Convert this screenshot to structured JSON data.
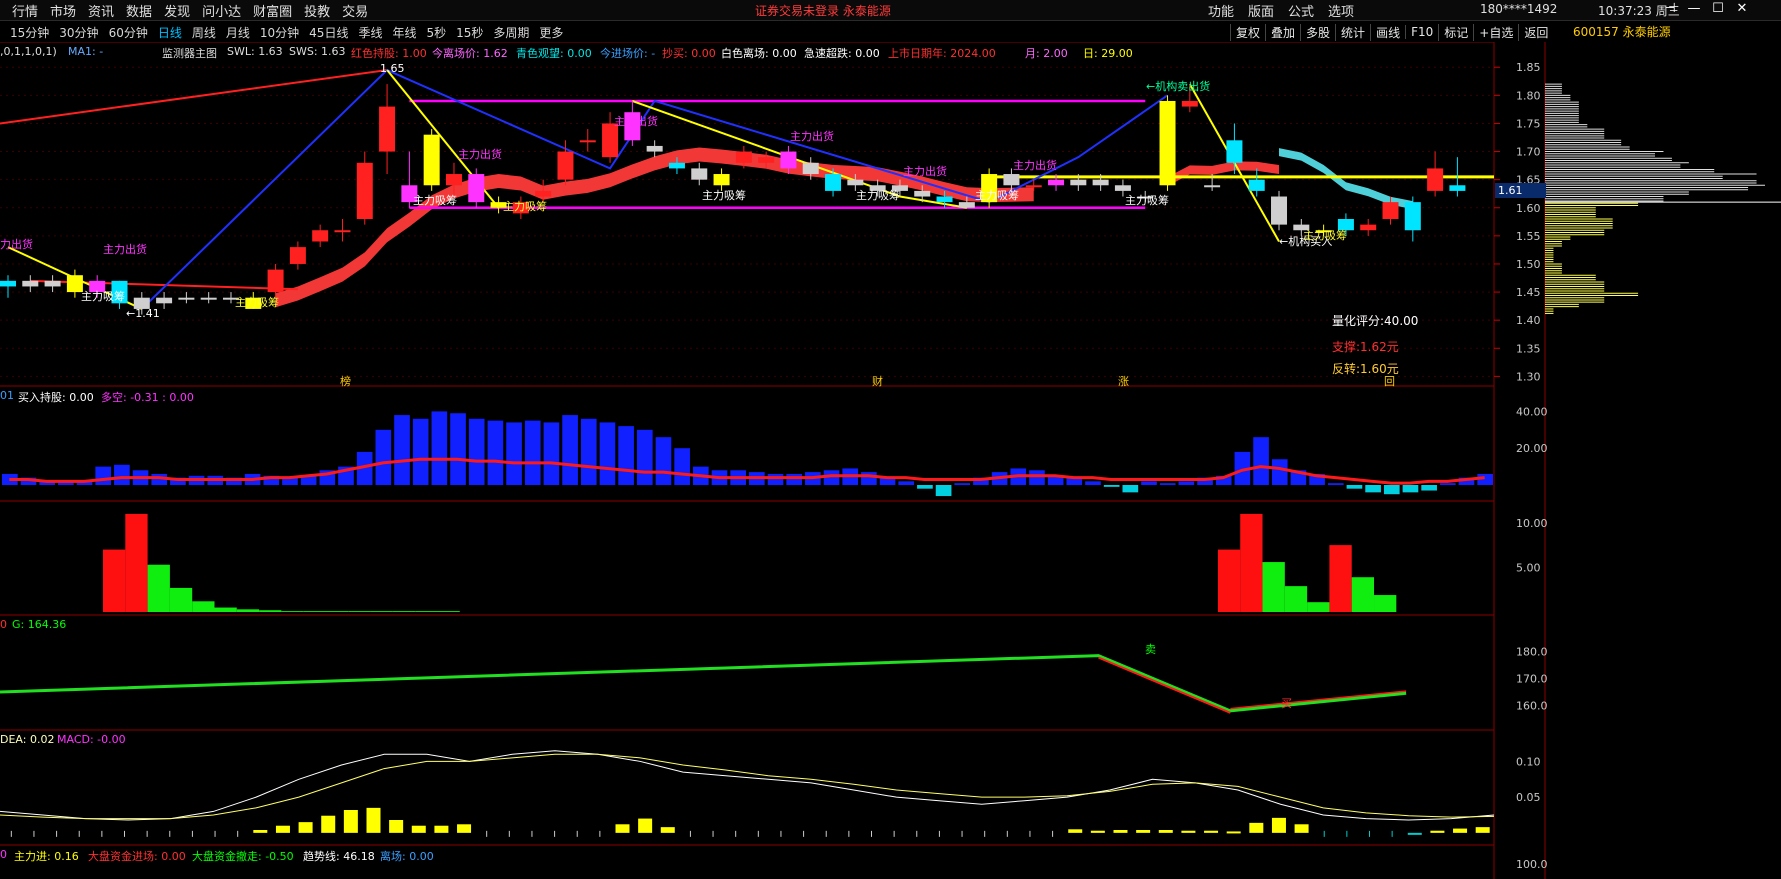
{
  "menu": [
    "行情",
    "市场",
    "资讯",
    "数据",
    "发现",
    "问小达",
    "财富圈",
    "投教",
    "交易"
  ],
  "center_msg": "证券交易未登录  永泰能源",
  "right_menu": [
    "功能",
    "版面",
    "公式",
    "选项"
  ],
  "account": "180****1492",
  "clock": "10:37:23 周三",
  "tabs": [
    "15分钟",
    "30分钟",
    "60分钟",
    "日线",
    "周线",
    "月线",
    "10分钟",
    "45日线",
    "季线",
    "年线",
    "5秒",
    "15秒",
    "多周期",
    "更多"
  ],
  "active_tab": "日线",
  "tools": [
    "复权",
    "叠加",
    "多股",
    "统计",
    "画线",
    "F10",
    "标记",
    "+自选",
    "返回"
  ],
  "stock": {
    "code": "600157",
    "name": "永泰能源"
  },
  "colors": {
    "up": "#ff2020",
    "down": "#00ff00",
    "accent": "#00bfff",
    "yellow": "#ffff00",
    "magenta": "#ff00ff"
  },
  "main_info": {
    "prefix": ",0,1,1,0,1)",
    "ma": "MA1: -",
    "title": "监测器主图",
    "swl": "SWL: 1.63",
    "sws": "SWS: 1.63",
    "red_hold": "红色持股: 1.00",
    "today_leave": "今离场价: 1.62",
    "cyan_watch": "青色观望: 0.00",
    "today_enter": "今进场价: -",
    "bottom_buy": "抄买: 0.00",
    "white_leave": "白色离场: 0.00",
    "super_drop": "急速超跌: 0.00",
    "listing_year": "上市日期年: 2024.00",
    "month": "月: 2.00",
    "day": "日: 29.00"
  },
  "annotations": {
    "inst_sell": "←机构卖出货",
    "inst_buy": "←机构买入",
    "big_out": "主力出货",
    "big_in": "主力吸筹",
    "left_out_cut": "力出货",
    "high_label": "1.65",
    "low_label": "←1.41",
    "events": [
      "榜",
      "财",
      "涨",
      "回"
    ]
  },
  "scores": {
    "quant": "量化评分:40.00",
    "support": "支撑:1.62元",
    "reverse": "反转:1.60元"
  },
  "panel2": {
    "prefix": "01",
    "buy_hold": "买入持股: 0.00",
    "long_short": "多空: -0.31 : 0.00"
  },
  "panel4": {
    "prefix": "0",
    "g": "G: 164.36",
    "sell": "卖",
    "buy": "买"
  },
  "panel5": {
    "prefix": "DEA: 0.02",
    "macd": "MACD: -0.00"
  },
  "panel6": {
    "prefix": "0",
    "main_in": "主力进: 0.16",
    "dp_in": "大盘资金进场: 0.00",
    "dp_out": "大盘资金撤走: -0.50",
    "trend": "趋势线: 46.18",
    "leave": "离场: 0.00"
  },
  "current_price": "1.61",
  "chart_data": {
    "type": "candlestick",
    "main_ticks": [
      1.85,
      1.8,
      1.75,
      1.7,
      1.65,
      1.6,
      1.55,
      1.5,
      1.45,
      1.4,
      1.35,
      1.3
    ],
    "ylim": [
      1.29,
      1.87
    ],
    "candles": [
      [
        1.47,
        1.46,
        1.48,
        1.44
      ],
      [
        1.46,
        1.47,
        1.48,
        1.45
      ],
      [
        1.46,
        1.47,
        1.48,
        1.45
      ],
      [
        1.48,
        1.45,
        1.49,
        1.44
      ],
      [
        1.45,
        1.47,
        1.48,
        1.44
      ],
      [
        1.47,
        1.43,
        1.47,
        1.42
      ],
      [
        1.44,
        1.42,
        1.45,
        1.41
      ],
      [
        1.43,
        1.44,
        1.45,
        1.42
      ],
      [
        1.44,
        1.44,
        1.45,
        1.43
      ],
      [
        1.44,
        1.44,
        1.45,
        1.43
      ],
      [
        1.44,
        1.44,
        1.45,
        1.43
      ],
      [
        1.44,
        1.42,
        1.45,
        1.42
      ],
      [
        1.45,
        1.49,
        1.5,
        1.44
      ],
      [
        1.5,
        1.53,
        1.54,
        1.49
      ],
      [
        1.54,
        1.56,
        1.57,
        1.53
      ],
      [
        1.56,
        1.56,
        1.58,
        1.54
      ],
      [
        1.58,
        1.68,
        1.7,
        1.57
      ],
      [
        1.7,
        1.78,
        1.82,
        1.66
      ],
      [
        1.64,
        1.61,
        1.7,
        1.6
      ],
      [
        1.73,
        1.64,
        1.74,
        1.63
      ],
      [
        1.64,
        1.66,
        1.68,
        1.62
      ],
      [
        1.66,
        1.61,
        1.67,
        1.6
      ],
      [
        1.61,
        1.6,
        1.62,
        1.59
      ],
      [
        1.59,
        1.61,
        1.62,
        1.58
      ],
      [
        1.62,
        1.63,
        1.65,
        1.61
      ],
      [
        1.65,
        1.7,
        1.72,
        1.64
      ],
      [
        1.72,
        1.72,
        1.74,
        1.7
      ],
      [
        1.69,
        1.75,
        1.77,
        1.68
      ],
      [
        1.77,
        1.72,
        1.79,
        1.71
      ],
      [
        1.7,
        1.71,
        1.72,
        1.69
      ],
      [
        1.68,
        1.67,
        1.69,
        1.66
      ],
      [
        1.67,
        1.65,
        1.68,
        1.64
      ],
      [
        1.64,
        1.66,
        1.67,
        1.63
      ],
      [
        1.68,
        1.7,
        1.71,
        1.67
      ],
      [
        1.68,
        1.69,
        1.7,
        1.67
      ],
      [
        1.67,
        1.7,
        1.71,
        1.66
      ],
      [
        1.66,
        1.68,
        1.69,
        1.65
      ],
      [
        1.66,
        1.63,
        1.67,
        1.62
      ],
      [
        1.64,
        1.65,
        1.66,
        1.63
      ],
      [
        1.63,
        1.64,
        1.65,
        1.62
      ],
      [
        1.63,
        1.64,
        1.65,
        1.62
      ],
      [
        1.63,
        1.62,
        1.64,
        1.61
      ],
      [
        1.62,
        1.61,
        1.63,
        1.6
      ],
      [
        1.6,
        1.61,
        1.62,
        1.6
      ],
      [
        1.66,
        1.61,
        1.67,
        1.6
      ],
      [
        1.64,
        1.66,
        1.67,
        1.63
      ],
      [
        1.64,
        1.64,
        1.65,
        1.63
      ],
      [
        1.64,
        1.65,
        1.66,
        1.63
      ],
      [
        1.64,
        1.65,
        1.66,
        1.63
      ],
      [
        1.64,
        1.65,
        1.66,
        1.63
      ],
      [
        1.64,
        1.63,
        1.65,
        1.62
      ],
      [
        1.62,
        1.62,
        1.63,
        1.61
      ],
      [
        1.64,
        1.79,
        1.8,
        1.63
      ],
      [
        1.78,
        1.79,
        1.82,
        1.77
      ],
      [
        1.64,
        1.64,
        1.66,
        1.63
      ],
      [
        1.72,
        1.68,
        1.75,
        1.66
      ],
      [
        1.65,
        1.63,
        1.67,
        1.62
      ],
      [
        1.62,
        1.57,
        1.63,
        1.56
      ],
      [
        1.57,
        1.56,
        1.58,
        1.55
      ],
      [
        1.56,
        1.56,
        1.57,
        1.55
      ],
      [
        1.58,
        1.56,
        1.59,
        1.55
      ],
      [
        1.56,
        1.57,
        1.58,
        1.55
      ],
      [
        1.58,
        1.61,
        1.62,
        1.57
      ],
      [
        1.61,
        1.56,
        1.62,
        1.54
      ],
      [
        1.63,
        1.67,
        1.7,
        1.62
      ],
      [
        1.64,
        1.63,
        1.69,
        1.62
      ]
    ],
    "profile_y": [
      1.85,
      1.8,
      1.75,
      1.7,
      1.65,
      1.6,
      1.55,
      1.5,
      1.45,
      1.4,
      1.35
    ],
    "panel2": {
      "ticks": [
        40,
        20
      ],
      "ylim": [
        0,
        50
      ],
      "bars": [
        6,
        4,
        2,
        2,
        2,
        10,
        11,
        8,
        6,
        4,
        5,
        5,
        4,
        6,
        5,
        4,
        5,
        8,
        10,
        18,
        30,
        38,
        36,
        40,
        39,
        36,
        35,
        34,
        35,
        34,
        38,
        36,
        34,
        32,
        30,
        26,
        20,
        10,
        8,
        8,
        7,
        6,
        6,
        7,
        8,
        9,
        7,
        4,
        2,
        -2,
        -6,
        1,
        4,
        7,
        9,
        8,
        5,
        4,
        2,
        -1,
        -4,
        2,
        1,
        2,
        4,
        5,
        18,
        26,
        14,
        8,
        6,
        1,
        -2,
        -4,
        -5,
        -4,
        -3,
        1,
        4,
        6
      ],
      "line": [
        3,
        3,
        2,
        2,
        2,
        3,
        4,
        4,
        4,
        3,
        3,
        3,
        3,
        3,
        4,
        4,
        5,
        6,
        8,
        10,
        12,
        13,
        14,
        14,
        14,
        13,
        13,
        12,
        12,
        12,
        11,
        10,
        9,
        8,
        7,
        7,
        6,
        5,
        4,
        4,
        4,
        4,
        4,
        4,
        5,
        5,
        5,
        4,
        4,
        3,
        3,
        3,
        3,
        4,
        5,
        5,
        5,
        4,
        4,
        3,
        3,
        3,
        3,
        3,
        3,
        4,
        8,
        10,
        9,
        7,
        5,
        4,
        3,
        2,
        1,
        1,
        2,
        2,
        3,
        4
      ]
    },
    "panel3": {
      "ticks": [
        10,
        5
      ],
      "ylim": [
        0,
        12
      ],
      "red": [
        0,
        0,
        0,
        0,
        7,
        11,
        0,
        0,
        0,
        0,
        0,
        0,
        0,
        0,
        0,
        0,
        0,
        0,
        0,
        0,
        0,
        0,
        0,
        0,
        0,
        0,
        0,
        0,
        0,
        0,
        0,
        0,
        0,
        0,
        0,
        0,
        0,
        0,
        0,
        0,
        0,
        0,
        0,
        0,
        0,
        0,
        0,
        0,
        0,
        0,
        0,
        0,
        0,
        0,
        7,
        11,
        0,
        0,
        0,
        7.5,
        0,
        0,
        0,
        0
      ],
      "green": [
        0,
        0,
        0,
        0,
        0,
        0,
        5.3,
        2.7,
        1.2,
        0.5,
        0.3,
        0.2,
        0.1,
        0.1,
        0.1,
        0.1,
        0.1,
        0.1,
        0.1,
        0.1,
        0,
        0,
        0,
        0,
        0,
        0,
        0,
        0,
        0,
        0,
        0,
        0,
        0,
        0,
        0,
        0,
        0,
        0,
        0,
        0,
        0,
        0,
        0,
        0,
        0,
        0,
        0,
        0,
        0,
        0,
        0,
        0,
        0,
        0,
        0,
        0,
        5.6,
        2.9,
        1.1,
        0,
        3.9,
        1.9
      ]
    },
    "panel4": {
      "ticks": [
        180,
        170,
        160
      ],
      "ylim": [
        152,
        188
      ],
      "line": [
        [
          0,
          165
        ],
        [
          50,
          178.5
        ],
        [
          56,
          158
        ],
        [
          64,
          164.5
        ]
      ]
    },
    "panel5": {
      "ticks": [
        0.1,
        0.05
      ],
      "ylim": [
        -0.01,
        0.13
      ],
      "dif": [
        0.03,
        0.025,
        0.02,
        0.018,
        0.02,
        0.03,
        0.05,
        0.075,
        0.095,
        0.11,
        0.11,
        0.1,
        0.11,
        0.115,
        0.11,
        0.1,
        0.085,
        0.08,
        0.075,
        0.07,
        0.06,
        0.05,
        0.045,
        0.04,
        0.045,
        0.05,
        0.06,
        0.075,
        0.07,
        0.06,
        0.04,
        0.025,
        0.02,
        0.018,
        0.02,
        0.025
      ],
      "dea": [
        0.025,
        0.022,
        0.02,
        0.02,
        0.02,
        0.025,
        0.035,
        0.05,
        0.07,
        0.09,
        0.1,
        0.1,
        0.105,
        0.11,
        0.11,
        0.105,
        0.095,
        0.088,
        0.08,
        0.075,
        0.068,
        0.06,
        0.055,
        0.05,
        0.05,
        0.052,
        0.058,
        0.068,
        0.07,
        0.065,
        0.05,
        0.035,
        0.028,
        0.024,
        0.022,
        0.023
      ],
      "macd": [
        0,
        0,
        0,
        0,
        0,
        0,
        0,
        0,
        0,
        0,
        0,
        0.004,
        0.01,
        0.015,
        0.024,
        0.032,
        0.035,
        0.018,
        0.01,
        0.01,
        0.012,
        0,
        0,
        0,
        0,
        0,
        0,
        0.012,
        0.02,
        0.008,
        0,
        0,
        0,
        0,
        0,
        0,
        0,
        0,
        0,
        0,
        0,
        0,
        0,
        0,
        0,
        0,
        0,
        0.005,
        0.003,
        0.004,
        0.004,
        0.004,
        0.003,
        0.003,
        0.002,
        0.014,
        0.021,
        0.012,
        0,
        0,
        0,
        0,
        -0.002,
        0.003,
        0.006,
        0.008
      ]
    },
    "panel6": {
      "ticks": [
        100.0
      ]
    }
  }
}
